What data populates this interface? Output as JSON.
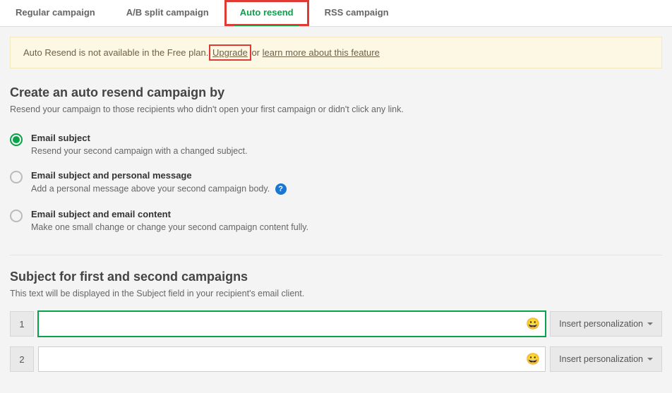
{
  "tabs": [
    {
      "label": "Regular campaign"
    },
    {
      "label": "A/B split campaign"
    },
    {
      "label": "Auto resend"
    },
    {
      "label": "RSS campaign"
    }
  ],
  "alert": {
    "prefix": "Auto Resend is not available in the Free plan. ",
    "upgrade": "Upgrade",
    "middle": " or ",
    "learn": "learn more about this feature"
  },
  "section1": {
    "title": "Create an auto resend campaign by",
    "sub": "Resend your campaign to those recipients who didn't open your first campaign or didn't click any link."
  },
  "options": [
    {
      "title": "Email subject",
      "desc": "Resend your second campaign with a changed subject."
    },
    {
      "title": "Email subject and personal message",
      "desc": "Add a personal message above your second campaign body."
    },
    {
      "title": "Email subject and email content",
      "desc": "Make one small change or change your second campaign content fully."
    }
  ],
  "section2": {
    "title": "Subject for first and second campaigns",
    "sub": "This text will be displayed in the Subject field in your recipient's email client."
  },
  "subject_rows": [
    {
      "num": "1",
      "value": ""
    },
    {
      "num": "2",
      "value": ""
    }
  ],
  "personalization_label": "Insert personalization",
  "help_glyph": "?"
}
